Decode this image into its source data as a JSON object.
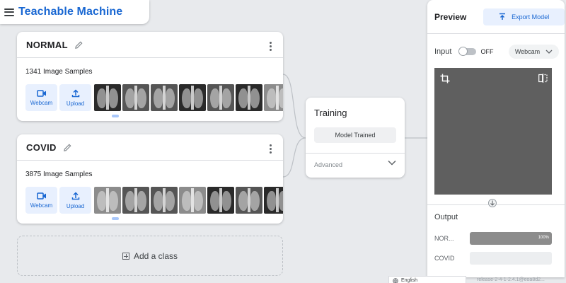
{
  "app": {
    "title": "Teachable Machine"
  },
  "classes": [
    {
      "name": "NORMAL",
      "sample_count": "1341 Image Samples",
      "webcam_label": "Webcam",
      "upload_label": "Upload",
      "thumb_tones": [
        "dark",
        "mid",
        "mid",
        "dark",
        "mid",
        "dark",
        "light"
      ]
    },
    {
      "name": "COVID",
      "sample_count": "3875 Image Samples",
      "webcam_label": "Webcam",
      "upload_label": "Upload",
      "thumb_tones": [
        "light",
        "mid",
        "mid",
        "light",
        "dark",
        "mid",
        "dark"
      ]
    }
  ],
  "add_class": {
    "label": "Add a class"
  },
  "training": {
    "title": "Training",
    "button_label": "Model Trained",
    "advanced_label": "Advanced"
  },
  "preview": {
    "title": "Preview",
    "export_label": "Export Model",
    "input_label": "Input",
    "toggle_state": "OFF",
    "source_select": "Webcam",
    "output_label": "Output",
    "outputs": [
      {
        "label": "NOR...",
        "percent": 100,
        "percent_label": "100%"
      },
      {
        "label": "COVID",
        "percent": 0,
        "percent_label": ""
      }
    ]
  },
  "footer": {
    "language": "English",
    "release": "release-2-4-1-2.4.1@eoa8d2..."
  },
  "colors": {
    "brand": "#1967d2",
    "accent_bg": "#e8f0fe",
    "bar_fill": "#8c8c8c",
    "canvas": "#e8eaed"
  },
  "icons": [
    "menu-icon",
    "pencil-icon",
    "more-vert-icon",
    "videocam-icon",
    "upload-icon",
    "export-icon",
    "chevron-down-icon",
    "crop-icon",
    "flip-icon",
    "arrow-down-icon",
    "add-box-icon",
    "globe-icon"
  ]
}
